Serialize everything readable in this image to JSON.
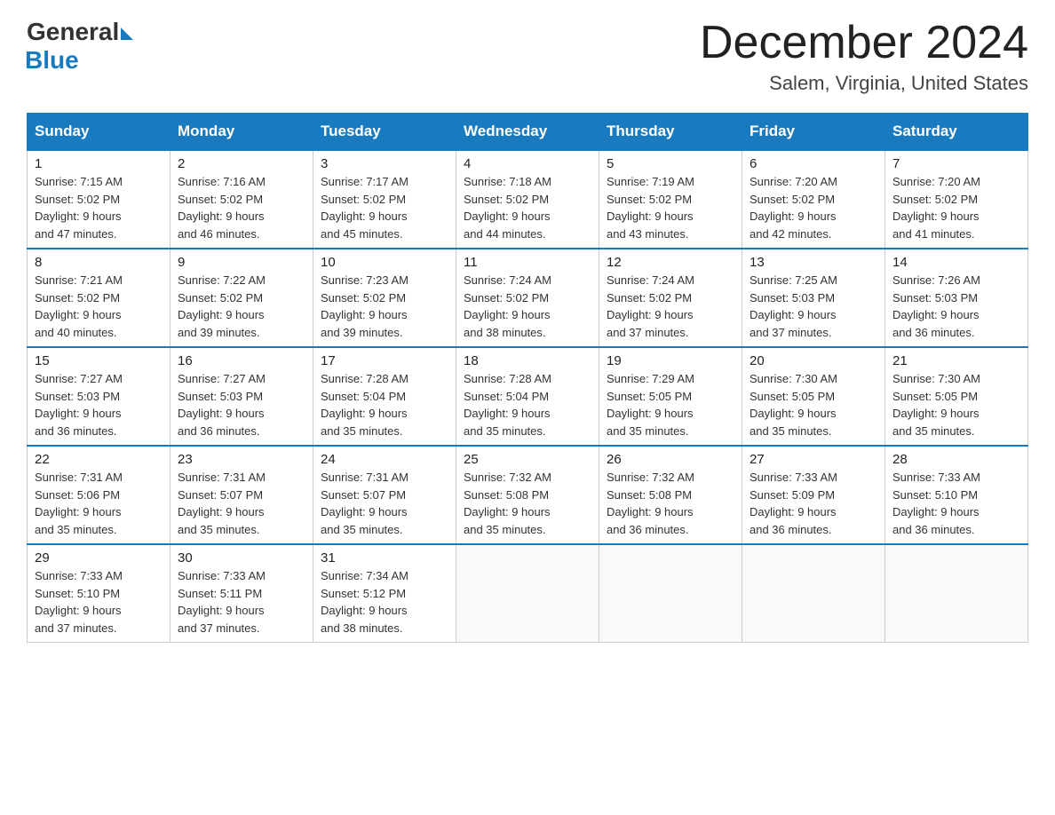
{
  "logo": {
    "general": "General",
    "blue": "Blue"
  },
  "title": "December 2024",
  "location": "Salem, Virginia, United States",
  "days_of_week": [
    "Sunday",
    "Monday",
    "Tuesday",
    "Wednesday",
    "Thursday",
    "Friday",
    "Saturday"
  ],
  "weeks": [
    [
      {
        "day": "1",
        "sunrise": "7:15 AM",
        "sunset": "5:02 PM",
        "daylight": "9 hours and 47 minutes."
      },
      {
        "day": "2",
        "sunrise": "7:16 AM",
        "sunset": "5:02 PM",
        "daylight": "9 hours and 46 minutes."
      },
      {
        "day": "3",
        "sunrise": "7:17 AM",
        "sunset": "5:02 PM",
        "daylight": "9 hours and 45 minutes."
      },
      {
        "day": "4",
        "sunrise": "7:18 AM",
        "sunset": "5:02 PM",
        "daylight": "9 hours and 44 minutes."
      },
      {
        "day": "5",
        "sunrise": "7:19 AM",
        "sunset": "5:02 PM",
        "daylight": "9 hours and 43 minutes."
      },
      {
        "day": "6",
        "sunrise": "7:20 AM",
        "sunset": "5:02 PM",
        "daylight": "9 hours and 42 minutes."
      },
      {
        "day": "7",
        "sunrise": "7:20 AM",
        "sunset": "5:02 PM",
        "daylight": "9 hours and 41 minutes."
      }
    ],
    [
      {
        "day": "8",
        "sunrise": "7:21 AM",
        "sunset": "5:02 PM",
        "daylight": "9 hours and 40 minutes."
      },
      {
        "day": "9",
        "sunrise": "7:22 AM",
        "sunset": "5:02 PM",
        "daylight": "9 hours and 39 minutes."
      },
      {
        "day": "10",
        "sunrise": "7:23 AM",
        "sunset": "5:02 PM",
        "daylight": "9 hours and 39 minutes."
      },
      {
        "day": "11",
        "sunrise": "7:24 AM",
        "sunset": "5:02 PM",
        "daylight": "9 hours and 38 minutes."
      },
      {
        "day": "12",
        "sunrise": "7:24 AM",
        "sunset": "5:02 PM",
        "daylight": "9 hours and 37 minutes."
      },
      {
        "day": "13",
        "sunrise": "7:25 AM",
        "sunset": "5:03 PM",
        "daylight": "9 hours and 37 minutes."
      },
      {
        "day": "14",
        "sunrise": "7:26 AM",
        "sunset": "5:03 PM",
        "daylight": "9 hours and 36 minutes."
      }
    ],
    [
      {
        "day": "15",
        "sunrise": "7:27 AM",
        "sunset": "5:03 PM",
        "daylight": "9 hours and 36 minutes."
      },
      {
        "day": "16",
        "sunrise": "7:27 AM",
        "sunset": "5:03 PM",
        "daylight": "9 hours and 36 minutes."
      },
      {
        "day": "17",
        "sunrise": "7:28 AM",
        "sunset": "5:04 PM",
        "daylight": "9 hours and 35 minutes."
      },
      {
        "day": "18",
        "sunrise": "7:28 AM",
        "sunset": "5:04 PM",
        "daylight": "9 hours and 35 minutes."
      },
      {
        "day": "19",
        "sunrise": "7:29 AM",
        "sunset": "5:05 PM",
        "daylight": "9 hours and 35 minutes."
      },
      {
        "day": "20",
        "sunrise": "7:30 AM",
        "sunset": "5:05 PM",
        "daylight": "9 hours and 35 minutes."
      },
      {
        "day": "21",
        "sunrise": "7:30 AM",
        "sunset": "5:05 PM",
        "daylight": "9 hours and 35 minutes."
      }
    ],
    [
      {
        "day": "22",
        "sunrise": "7:31 AM",
        "sunset": "5:06 PM",
        "daylight": "9 hours and 35 minutes."
      },
      {
        "day": "23",
        "sunrise": "7:31 AM",
        "sunset": "5:07 PM",
        "daylight": "9 hours and 35 minutes."
      },
      {
        "day": "24",
        "sunrise": "7:31 AM",
        "sunset": "5:07 PM",
        "daylight": "9 hours and 35 minutes."
      },
      {
        "day": "25",
        "sunrise": "7:32 AM",
        "sunset": "5:08 PM",
        "daylight": "9 hours and 35 minutes."
      },
      {
        "day": "26",
        "sunrise": "7:32 AM",
        "sunset": "5:08 PM",
        "daylight": "9 hours and 36 minutes."
      },
      {
        "day": "27",
        "sunrise": "7:33 AM",
        "sunset": "5:09 PM",
        "daylight": "9 hours and 36 minutes."
      },
      {
        "day": "28",
        "sunrise": "7:33 AM",
        "sunset": "5:10 PM",
        "daylight": "9 hours and 36 minutes."
      }
    ],
    [
      {
        "day": "29",
        "sunrise": "7:33 AM",
        "sunset": "5:10 PM",
        "daylight": "9 hours and 37 minutes."
      },
      {
        "day": "30",
        "sunrise": "7:33 AM",
        "sunset": "5:11 PM",
        "daylight": "9 hours and 37 minutes."
      },
      {
        "day": "31",
        "sunrise": "7:34 AM",
        "sunset": "5:12 PM",
        "daylight": "9 hours and 38 minutes."
      },
      null,
      null,
      null,
      null
    ]
  ],
  "labels": {
    "sunrise": "Sunrise: ",
    "sunset": "Sunset: ",
    "daylight": "Daylight: "
  }
}
